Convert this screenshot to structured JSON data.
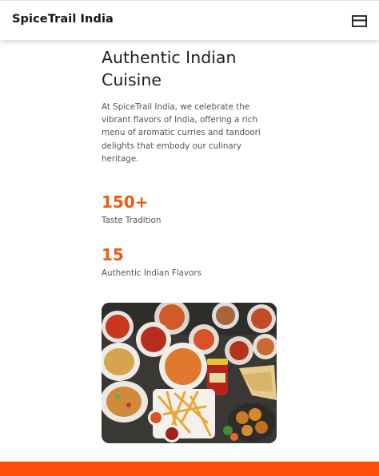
{
  "header": {
    "brand": "SpiceTrail India",
    "menu_icon": "menu-icon"
  },
  "hero": {
    "heading_line_1": "Authentic Indian",
    "heading_line_2": "Cuisine",
    "intro": "At SpiceTrail India, we celebrate the vibrant flavors of India, offering a rich menu of aromatic curries and tandoori delights that embody our culinary heritage."
  },
  "stats": [
    {
      "value": "150+",
      "label": "Taste Tradition"
    },
    {
      "value": "15",
      "label": "Authentic Indian Flavors"
    }
  ],
  "colors": {
    "accent": "#f15a10",
    "footer": "#ff4f0b",
    "text": "#1d1d1d",
    "muted": "#555555"
  },
  "image": {
    "subject": "food-platter-image"
  }
}
